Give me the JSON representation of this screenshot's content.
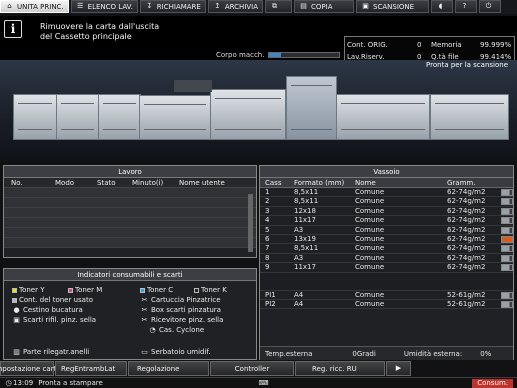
{
  "tabs": [
    {
      "label": "UNITA PRINC.",
      "icon": "home-icon",
      "active": true
    },
    {
      "label": "ELENCO LAV.",
      "icon": "list-icon"
    },
    {
      "label": "RICHIAMARE",
      "icon": "recall-icon"
    },
    {
      "label": "ARCHIVIA",
      "icon": "archive-icon"
    },
    {
      "label": "",
      "icon": "copy-document-icon"
    },
    {
      "label": "COPIA",
      "icon": "copy-icon"
    },
    {
      "label": "SCANSIONE",
      "icon": "scan-icon"
    },
    {
      "label": "",
      "icon": "volume-icon"
    },
    {
      "label": "?",
      "icon": "help-icon"
    },
    {
      "label": "",
      "icon": "power-icon"
    }
  ],
  "message": {
    "line1": "Rimuovere la carta dall'uscita",
    "line2": "del Cassetto principale"
  },
  "corpo": "Corpo macch.",
  "counters": {
    "cont_orig_label": "Cont. ORIG.",
    "cont_orig_value": "0",
    "memory_label": "Memoria",
    "memory_value": "99.999%",
    "lav_riserv_label": "Lav.Riserv.",
    "lav_riserv_value": "0",
    "q_file_label": "Q.tà file",
    "q_file_value": "99.414%"
  },
  "machine_status": "Pronta per la scansione",
  "lavoro": {
    "title": "Lavoro",
    "columns": [
      "No.",
      "Modo",
      "Stato",
      "Minuto(i)",
      "Nome utente"
    ]
  },
  "consumables": {
    "title": "Indicatori consumabili e scarti",
    "items": [
      {
        "label": "Toner Y",
        "color": "#e8e100"
      },
      {
        "label": "Toner M",
        "color": "#df3e8b"
      },
      {
        "label": "Toner C",
        "color": "#1ea9e8"
      },
      {
        "label": "Toner K",
        "color": "#222222"
      },
      {
        "label": "Cont. del toner usato"
      },
      {
        "label": "Cartuccia Pinzatrice"
      },
      {
        "label": "Cestino bucatura"
      },
      {
        "label": "Box scarti pinzatura"
      },
      {
        "label": "Scarti rifil. pinz. sella"
      },
      {
        "label": "Ricevitore pinz. sella"
      },
      {
        "label": "Cas. Cyclone"
      },
      {
        "label": "Parte rilegatr.anelli"
      },
      {
        "label": "Serbatoio umidif."
      }
    ]
  },
  "vassoio": {
    "title": "Vassoio",
    "headers": [
      "Cass",
      "Formato (mm)",
      "Nome",
      "Gramm."
    ],
    "rows": [
      {
        "cass": "1",
        "format": "8,5x11",
        "name": "Comune",
        "gramm": "62-74g/m2"
      },
      {
        "cass": "2",
        "format": "8,5x11",
        "name": "Comune",
        "gramm": "62-74g/m2"
      },
      {
        "cass": "3",
        "format": "12x18",
        "name": "Comune",
        "gramm": "62-74g/m2"
      },
      {
        "cass": "4",
        "format": "11x17",
        "name": "Comune",
        "gramm": "62-74g/m2"
      },
      {
        "cass": "5",
        "format": "A3",
        "name": "Comune",
        "gramm": "62-74g/m2"
      },
      {
        "cass": "6",
        "format": "13x19",
        "name": "Comune",
        "gramm": "62-74g/m2",
        "alert": true
      },
      {
        "cass": "7",
        "format": "8,5x11",
        "name": "Comune",
        "gramm": "62-74g/m2"
      },
      {
        "cass": "8",
        "format": "A3",
        "name": "Comune",
        "gramm": "62-74g/m2"
      },
      {
        "cass": "9",
        "format": "11x17",
        "name": "Comune",
        "gramm": "62-74g/m2"
      },
      {
        "cass": "PI1",
        "format": "A4",
        "name": "Comune",
        "gramm": "52-61g/m2"
      },
      {
        "cass": "PI2",
        "format": "A4",
        "name": "Comune",
        "gramm": "52-61g/m2"
      }
    ],
    "temp": "Temp.esterna",
    "temp_value": "0Gradi",
    "humidity": "Umidità esterna:",
    "humidity_value": "0%"
  },
  "bottom_buttons": [
    {
      "label": "Impostazione carta"
    },
    {
      "label": "RegEntrambLat"
    },
    {
      "label": "Regolazione"
    },
    {
      "label": "Controller"
    },
    {
      "label": "Reg. ricc. RU"
    }
  ],
  "status": {
    "time": "13:09",
    "text": "Pronta a stampare",
    "consum": "Consum."
  }
}
